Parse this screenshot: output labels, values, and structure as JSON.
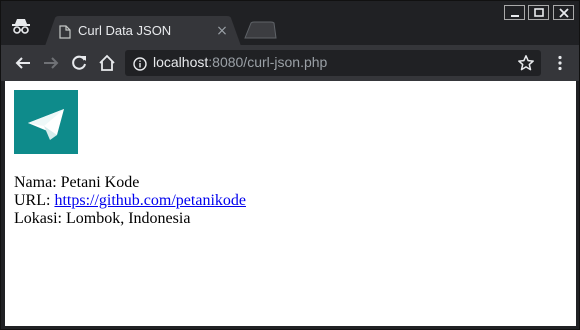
{
  "browser": {
    "tab": {
      "title": "Curl Data JSON",
      "close_glyph": "×"
    },
    "address_bar": {
      "host": "localhost",
      "rest": ":8080/curl-json.php"
    },
    "icons": {
      "incognito": "incognito-icon",
      "tab_page": "document-icon",
      "back": "back-arrow-icon",
      "forward": "forward-arrow-icon",
      "reload": "reload-icon",
      "home": "home-icon",
      "site_info": "info-icon",
      "bookmark": "star-icon",
      "menu": "kebab-menu-icon"
    }
  },
  "page": {
    "logo": "paper-plane-logo",
    "logo_color": "#0e8b8b",
    "fields": {
      "name_label": "Nama:",
      "name_value": "Petani Kode",
      "url_label": "URL:",
      "url_value": "https://github.com/petanikode",
      "location_label": "Lokasi:",
      "location_value": "Lombok, Indonesia"
    }
  }
}
